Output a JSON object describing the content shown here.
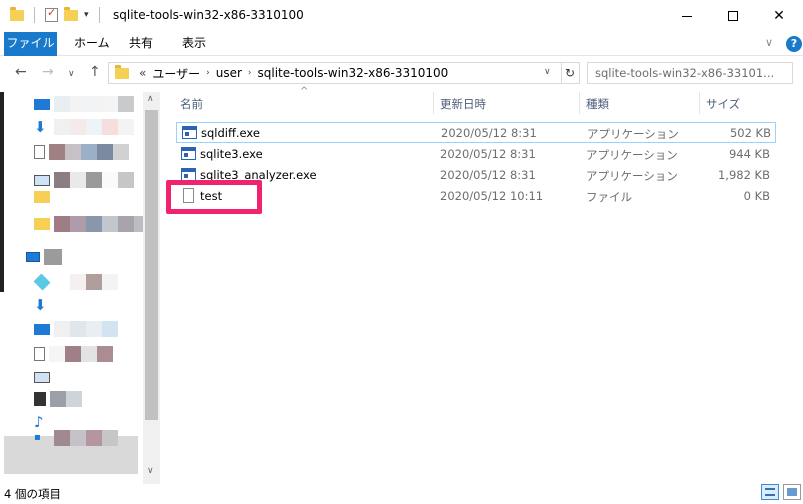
{
  "window": {
    "title": "sqlite-tools-win32-x86-3310100",
    "controls": {
      "minimize": "—",
      "maximize": "□",
      "close": "✕"
    }
  },
  "ribbon": {
    "tabs": [
      "ファイル",
      "ホーム",
      "共有",
      "表示"
    ],
    "expand_icon": "chevron-down-icon",
    "help_label": "?"
  },
  "address_bar": {
    "back": "←",
    "forward": "→",
    "recent": "∨",
    "up": "↑",
    "overflow": "«",
    "breadcrumbs": [
      "ユーザー",
      "user",
      "sqlite-tools-win32-x86-3310100"
    ],
    "refresh": "↻"
  },
  "search": {
    "placeholder": "sqlite-tools-win32-x86-33101..."
  },
  "file_list": {
    "columns": {
      "name": "名前",
      "date": "更新日時",
      "type": "種類",
      "size": "サイズ"
    },
    "rows": [
      {
        "name": "sqldiff.exe",
        "date": "2020/05/12 8:31",
        "type": "アプリケーション",
        "size": "502 KB",
        "icon": "exe-icon"
      },
      {
        "name": "sqlite3.exe",
        "date": "2020/05/12 8:31",
        "type": "アプリケーション",
        "size": "944 KB",
        "icon": "exe-icon"
      },
      {
        "name": "sqlite3_analyzer.exe",
        "date": "2020/05/12 8:31",
        "type": "アプリケーション",
        "size": "1,982 KB",
        "icon": "exe-icon"
      },
      {
        "name": "test",
        "date": "2020/05/12 10:11",
        "type": "ファイル",
        "size": "0 KB",
        "icon": "file-icon"
      }
    ]
  },
  "status_bar": {
    "item_count": "4 個の項目"
  },
  "colors": {
    "accent": "#1979ca",
    "highlight_box": "#f0246e",
    "selection_border": "#99d1ff"
  }
}
